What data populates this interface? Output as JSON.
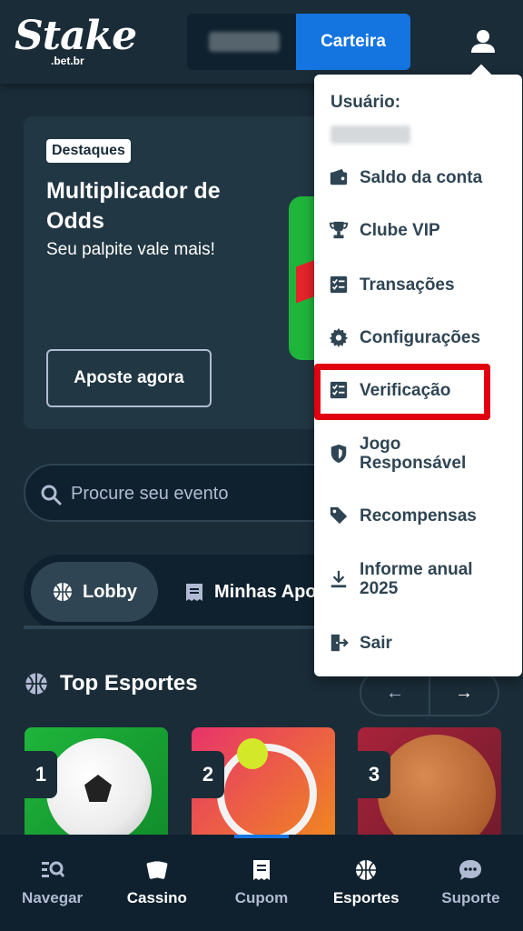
{
  "header": {
    "logo_text": "Stake",
    "logo_domain": ".bet.br",
    "wallet_label": "Carteira"
  },
  "banner": {
    "tag": "Destaques",
    "title": "Multiplicador de Odds",
    "subtitle": "Seu palpite vale mais!",
    "cta": "Aposte agora"
  },
  "search": {
    "placeholder": "Procure seu evento"
  },
  "tabs": [
    {
      "label": "Lobby",
      "active": true
    },
    {
      "label": "Minhas Apo"
    }
  ],
  "top_sports": {
    "title": "Top Esportes",
    "cards": [
      {
        "rank": "1",
        "sport": "soccer"
      },
      {
        "rank": "2",
        "sport": "tennis"
      },
      {
        "rank": "3",
        "sport": "basketball"
      }
    ]
  },
  "bottom_nav": [
    {
      "label": "Navegar",
      "icon": "browse-icon"
    },
    {
      "label": "Cassino",
      "icon": "cards-icon"
    },
    {
      "label": "Cupom",
      "icon": "betslip-icon",
      "active": true
    },
    {
      "label": "Esportes",
      "icon": "sports-icon"
    },
    {
      "label": "Suporte",
      "icon": "chat-icon"
    }
  ],
  "user_menu": {
    "user_label": "Usuário:",
    "items": [
      {
        "label": "Saldo da conta",
        "icon": "wallet-icon"
      },
      {
        "label": "Clube VIP",
        "icon": "trophy-icon"
      },
      {
        "label": "Transações",
        "icon": "checklist-icon"
      },
      {
        "label": "Configurações",
        "icon": "gear-icon"
      },
      {
        "label": "Verificação",
        "icon": "checklist-icon",
        "highlighted": true
      },
      {
        "label": "Jogo Responsável",
        "icon": "shield-icon"
      },
      {
        "label": "Recompensas",
        "icon": "tag-icon"
      },
      {
        "label": "Informe anual 2025",
        "icon": "download-icon"
      },
      {
        "label": "Sair",
        "icon": "logout-icon"
      }
    ]
  },
  "colors": {
    "background": "#1a2c38",
    "accent_blue": "#1475e1",
    "highlight_red": "#e0000f"
  }
}
